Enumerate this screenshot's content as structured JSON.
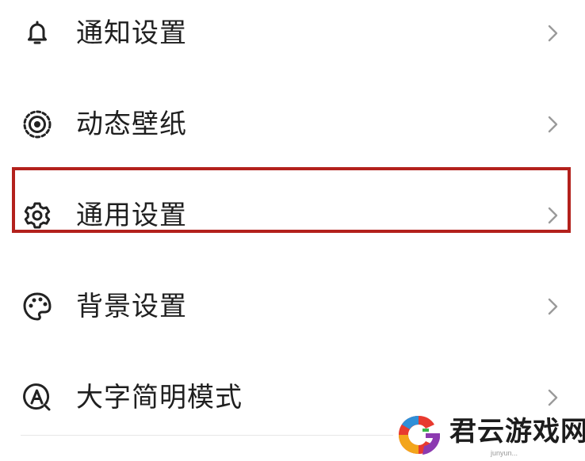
{
  "menu": {
    "items": [
      {
        "label": "通知设置",
        "icon": "bell-icon"
      },
      {
        "label": "动态壁纸",
        "icon": "live-wallpaper-icon"
      },
      {
        "label": "通用设置",
        "icon": "gear-icon"
      },
      {
        "label": "背景设置",
        "icon": "palette-icon"
      },
      {
        "label": "大字简明模式",
        "icon": "large-text-icon"
      }
    ],
    "highlighted_item": "通用设置"
  },
  "watermark": {
    "text": "君云游戏网",
    "sub": "junyun..."
  },
  "colors": {
    "text": "#1f1f1f",
    "chevron": "#9a9a9a",
    "highlight_border": "#b3211c",
    "icon": "#222222"
  }
}
